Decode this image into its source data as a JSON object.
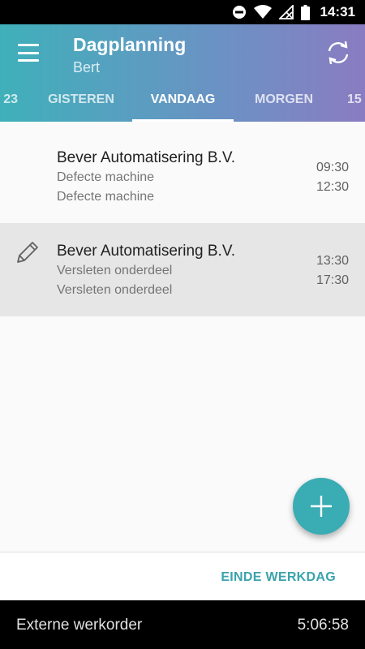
{
  "status_bar": {
    "time": "14:31"
  },
  "app_bar": {
    "title": "Dagplanning",
    "subtitle": "Bert"
  },
  "tabs": [
    {
      "label": "23",
      "active": false
    },
    {
      "label": "GISTEREN",
      "active": false
    },
    {
      "label": "VANDAAG",
      "active": true
    },
    {
      "label": "MORGEN",
      "active": false
    },
    {
      "label": "15",
      "active": false
    }
  ],
  "appointments": [
    {
      "company": "Bever Automatisering B.V.",
      "line1": "Defecte machine",
      "line2": "Defecte machine",
      "start": "09:30",
      "end": "12:30",
      "selected": false
    },
    {
      "company": "Bever Automatisering B.V.",
      "line1": "Versleten onderdeel",
      "line2": "Versleten onderdeel",
      "start": "13:30",
      "end": "17:30",
      "selected": true
    }
  ],
  "bottom_bar": {
    "end_label": "EINDE WERKDAG"
  },
  "footer": {
    "label": "Externe werkorder",
    "timer": "5:06:58"
  },
  "colors": {
    "accent": "#3aacb4",
    "gradient_start": "#3fb0ba",
    "gradient_end": "#8a7cc2"
  }
}
